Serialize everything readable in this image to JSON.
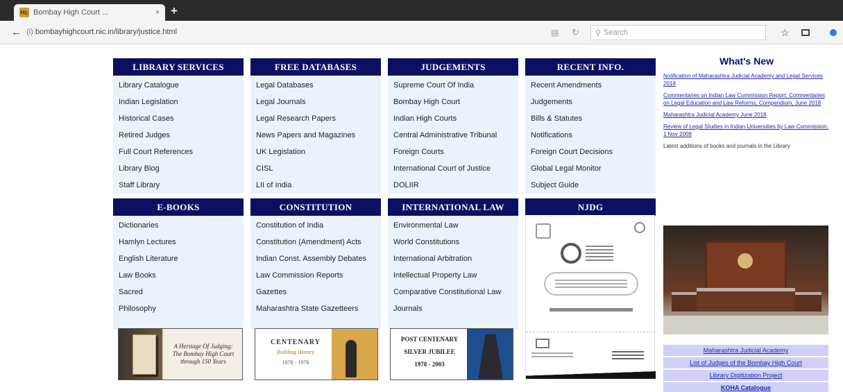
{
  "browser": {
    "tab_title": "Bombay High Court ...",
    "favicon_text": "Hc",
    "tab_close": "×",
    "new_tab": "+",
    "url_prefix": "(i)",
    "url": "bombayhighcourt.nic.in/library/justice.html",
    "search_placeholder": "Search",
    "icons": [
      "back-arrow-icon",
      "reader-icon",
      "reload-icon",
      "search-icon",
      "star-icon",
      "library-icon",
      "extension-icon"
    ]
  },
  "panels": [
    {
      "title": "LIBRARY SERVICES",
      "items": [
        "Library Catalogue",
        "Indian Legislation",
        "Historical Cases",
        "Retired Judges",
        "Full Court References",
        "Library Blog",
        "Staff Library"
      ]
    },
    {
      "title": "FREE DATABASES",
      "items": [
        "Legal Databases",
        "Legal Journals",
        "Legal Research Papers",
        "News Papers and Magazines",
        "UK Legislation",
        "CISL",
        "LII of India"
      ]
    },
    {
      "title": "JUDGEMENTS",
      "items": [
        "Supreme Court Of India",
        "Bombay High Court",
        "Indian High Courts",
        "Central Administrative Tribunal",
        "Foreign Courts",
        "International Court of Justice",
        "DOLIIR"
      ]
    },
    {
      "title": "RECENT INFO.",
      "items": [
        "Recent Amendments",
        "Judgements",
        "Bills & Statutes",
        "Notifications",
        "Foreign Court Decisions",
        "Global Legal Monitor",
        "Subject Guide"
      ]
    },
    {
      "title": "E-BOOKS",
      "items": [
        "Dictionaries",
        "Hamlyn Lectures",
        "English Literature",
        "Law Books",
        "Sacred",
        "Philosophy"
      ]
    },
    {
      "title": "CONSTITUTION",
      "items": [
        "Constitution of India",
        "Constitution (Amendment) Acts",
        "Indian Const. Assembly Debates",
        "Law Commission Reports",
        "Gazettes",
        "Maharashtra State Gazetteers"
      ]
    },
    {
      "title": "INTERNATIONAL LAW",
      "items": [
        "Environmental Law",
        "World Constitutions",
        "International Arbitration",
        "Intellectual Property Law",
        "Comparative Constitutional Law",
        "Journals"
      ]
    },
    {
      "title": "NJDG",
      "items": []
    }
  ],
  "banners": {
    "b1_text": "A Heritage Of Judging: The Bombay High Court through 150 Years",
    "b2_line1": "CENTENARY",
    "b2_line2": "Building History",
    "b2_line3": "1878 - 1978",
    "b3_line1": "POST CENTENARY",
    "b3_line2": "SILVER JUBILEE",
    "b3_line3": "1978 - 2003"
  },
  "whats_new": {
    "title": "What's New",
    "items": [
      {
        "text": "Notification of Maharashtra Judicial Academy and Legal Services 2018",
        "link": true
      },
      {
        "text": "Commentaries on Indian Law Commission Report: Commentaries on Legal Education and Law Reforms, Compendium, June 2018",
        "link": true
      },
      {
        "text": "Maharashtra Judicial Academy June 2018",
        "link": true
      },
      {
        "text": "Review of Legal Studies in Indian Universities by Law Commission, 1 Nov 2008",
        "link": true
      },
      {
        "text": "Latest additions of books and journals in the Library",
        "link": false
      }
    ]
  },
  "side_links": [
    {
      "text": "Maharashtra Judicial Academy",
      "bold": false
    },
    {
      "text": "List of Judges of the Bombay High Court",
      "bold": false
    },
    {
      "text": "Library Digitization Project",
      "bold": false
    },
    {
      "text": "KOHA Catalogue",
      "bold": true
    }
  ]
}
